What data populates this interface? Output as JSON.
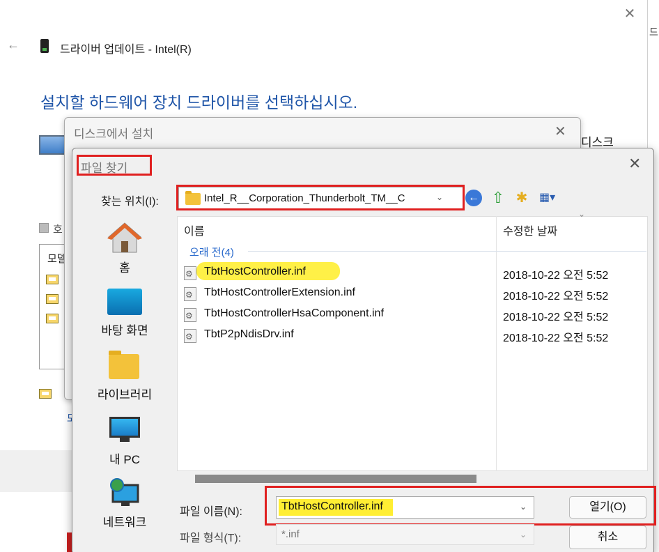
{
  "wizard": {
    "title": "드라이버 업데이트 - Intel(R)",
    "heading": "설치할 하드웨어 장치 드라이버를 선택하십시오.",
    "close_glyph": "✕",
    "back_glyph": "←",
    "right_edge_text": "드 ",
    "disk_label": "디스크",
    "compat_text": "호",
    "model_header": "모델",
    "have_disk_link": "모"
  },
  "disk_dialog": {
    "title": "디스크에서 설치",
    "close_glyph": "✕"
  },
  "file_dialog": {
    "title": "파일 찾기",
    "close_glyph": "✕",
    "lookin_label": "찾는 위치(I):",
    "lookin_value": "Intel_R__Corporation_Thunderbolt_TM__C",
    "chevron": "⌄",
    "toolbar": {
      "back_glyph": "←",
      "up_glyph": "⇧",
      "newfolder_glyph": "✱",
      "view_glyph": "▦▾"
    },
    "places": [
      {
        "label": "홈",
        "icon": "home-icon"
      },
      {
        "label": "바탕 화면",
        "icon": "desktop-icon"
      },
      {
        "label": "라이브러리",
        "icon": "library-icon"
      },
      {
        "label": "내 PC",
        "icon": "pc-icon"
      },
      {
        "label": "네트워크",
        "icon": "network-icon"
      }
    ],
    "columns": {
      "name": "이름",
      "date": "수정한 날짜",
      "sort_glyph": "⌄"
    },
    "group_label": "오래 전(4)",
    "files": [
      {
        "name": "TbtHostController.inf",
        "date": "2018-10-22 오전 5:52"
      },
      {
        "name": "TbtHostControllerExtension.inf",
        "date": "2018-10-22 오전 5:52"
      },
      {
        "name": "TbtHostControllerHsaComponent.inf",
        "date": "2018-10-22 오전 5:52"
      },
      {
        "name": "TbtP2pNdisDrv.inf",
        "date": "2018-10-22 오전 5:52"
      }
    ],
    "filename_label": "파일 이름(N):",
    "filename_value": "TbtHostController.inf",
    "filetype_label": "파일 형식(T):",
    "filetype_value": "*.inf",
    "open_button": "열기(O)",
    "cancel_button": "취소"
  },
  "colors": {
    "heading_blue": "#1f55a8",
    "annotation_red": "#e02020",
    "highlight_yellow": "#ffee33",
    "group_blue": "#2a6acc"
  }
}
